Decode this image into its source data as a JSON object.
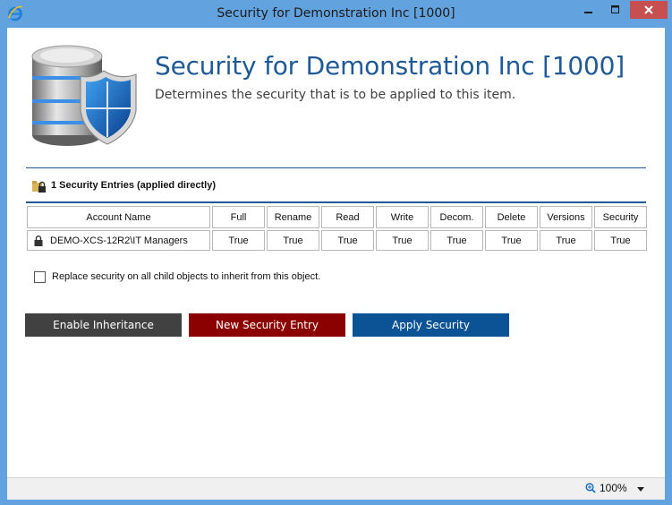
{
  "window": {
    "title": "Security for Demonstration Inc [1000]"
  },
  "header": {
    "title": "Security for Demonstration Inc [1000]",
    "subtitle": "Determines the security that is to be applied to this item."
  },
  "entries": {
    "label": "1 Security Entries (applied directly)"
  },
  "table": {
    "headers": [
      "Account Name",
      "Full",
      "Rename",
      "Read",
      "Write",
      "Decom.",
      "Delete",
      "Versions",
      "Security"
    ],
    "rows": [
      {
        "account": "DEMO-XCS-12R2\\IT Managers",
        "full": "True",
        "rename": "True",
        "read": "True",
        "write": "True",
        "decom": "True",
        "delete": "True",
        "versions": "True",
        "security": "True"
      }
    ]
  },
  "options": {
    "replace_child_label": "Replace security on all child objects to inherit from this object."
  },
  "buttons": {
    "enable_inheritance": "Enable Inheritance",
    "new_entry": "New Security Entry",
    "apply": "Apply Security"
  },
  "status": {
    "zoom": "100%"
  },
  "colors": {
    "accent": "#1f5a96",
    "enable_btn": "#414141",
    "new_btn": "#8b0000",
    "apply_btn": "#0b5394",
    "close_btn": "#c74f4f"
  }
}
